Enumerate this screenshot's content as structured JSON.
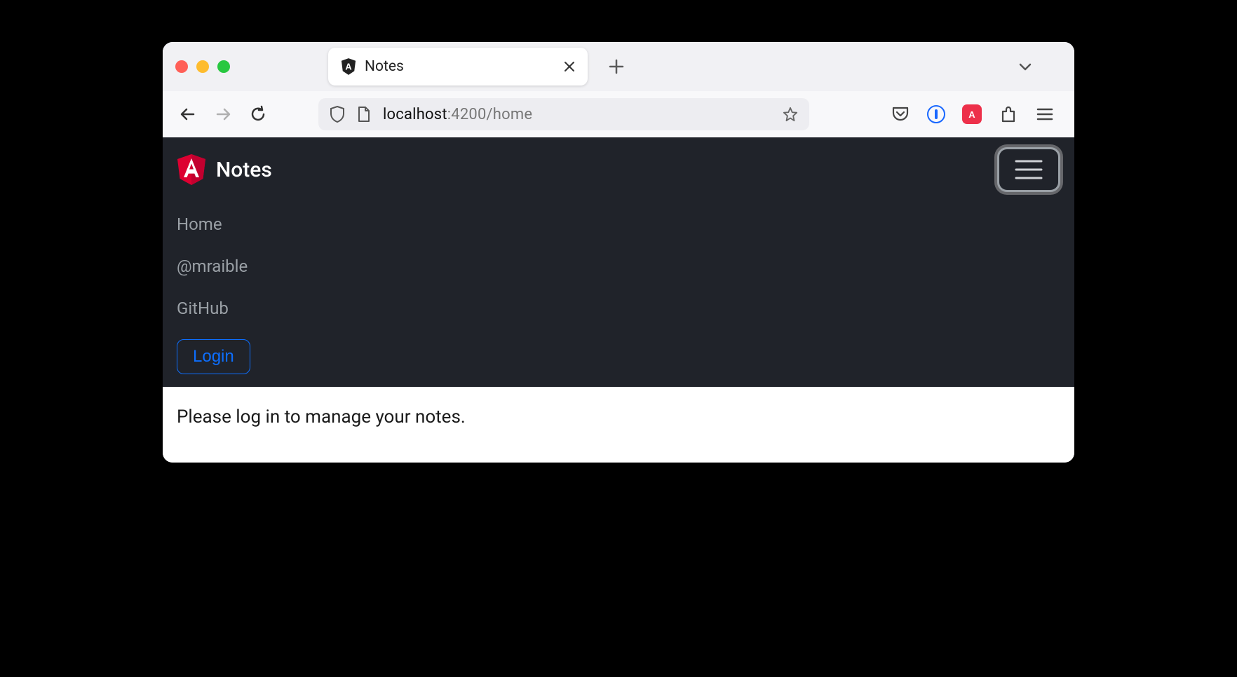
{
  "browser": {
    "tab": {
      "title": "Notes"
    },
    "traffic_lights": [
      "close",
      "minimize",
      "zoom"
    ],
    "address": {
      "host": "localhost",
      "path": ":4200/home"
    },
    "ext": {
      "onepassword": "①",
      "red_badge": "A"
    }
  },
  "app": {
    "brand": "Notes",
    "nav": {
      "items": [
        {
          "label": "Home"
        },
        {
          "label": "@mraible"
        },
        {
          "label": "GitHub"
        }
      ],
      "login": "Login"
    },
    "content": {
      "message": "Please log in to manage your notes."
    }
  }
}
